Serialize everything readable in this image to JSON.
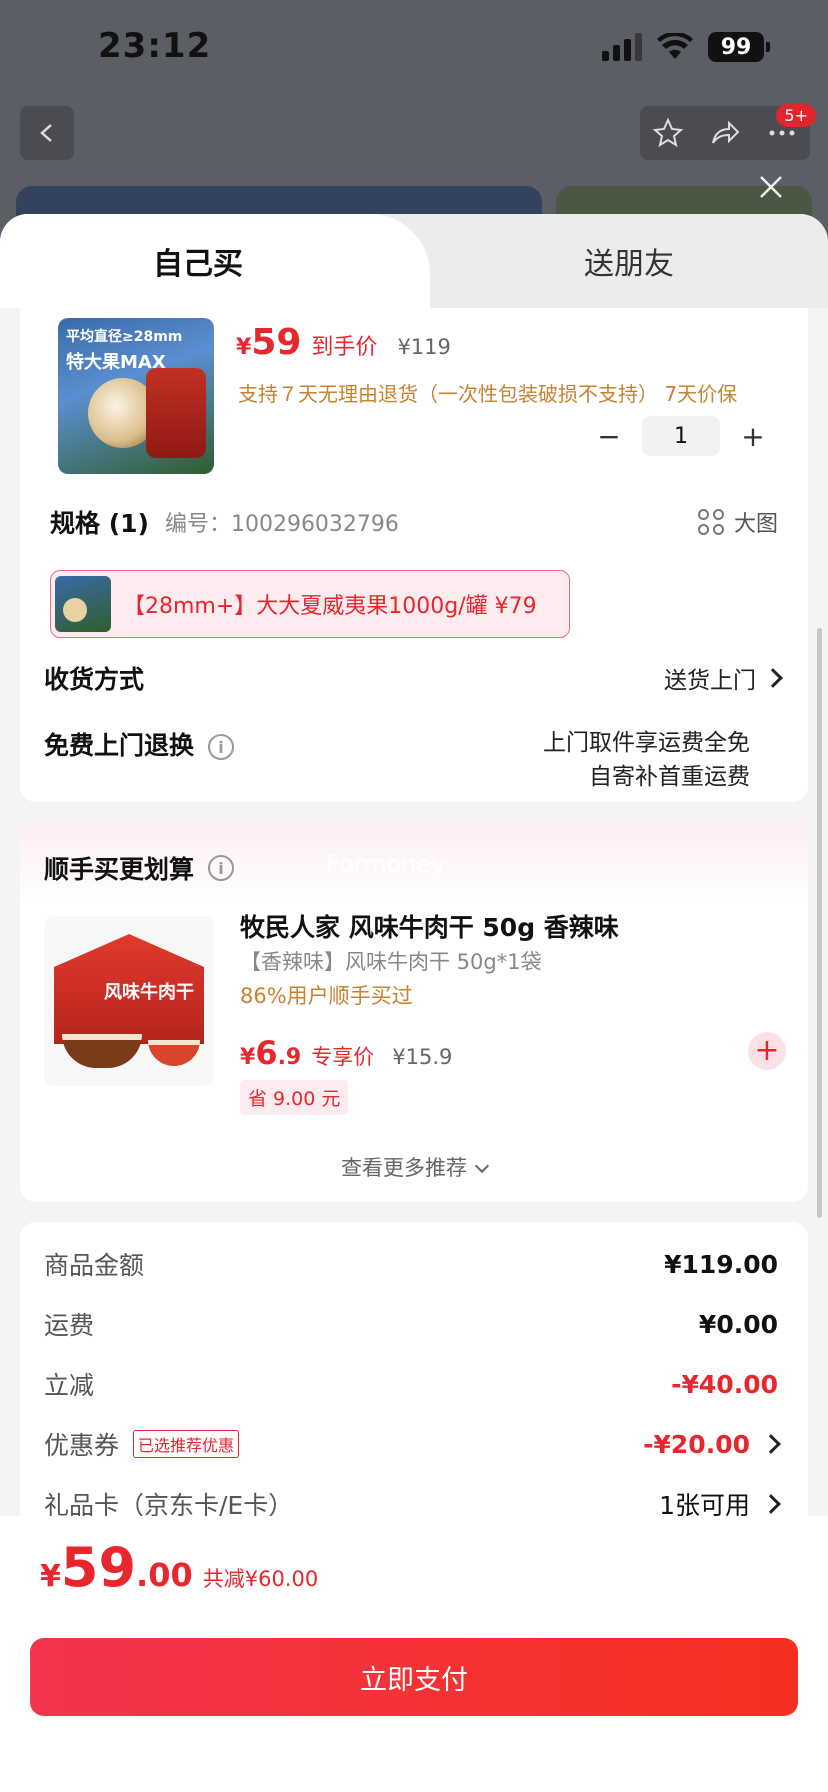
{
  "status": {
    "time": "23:12",
    "battery": "99"
  },
  "nav": {
    "badge": "5+"
  },
  "tabs": {
    "self": "自己买",
    "gift": "送朋友"
  },
  "product": {
    "image_text_1": "平均直径≥28mm",
    "image_text_2": "特大果MAX",
    "price_currency": "¥",
    "price": "59",
    "price_label": "到手价",
    "original_price": "¥119",
    "return_note": "支持７天无理由退货（一次性包装破损不支持） 7天价保",
    "quantity": "1",
    "qty_minus": "−",
    "qty_plus": "+"
  },
  "spec": {
    "title": "规格 (1)",
    "number": "编号：100296032796",
    "big_image": "大图",
    "selected_sku": "【28mm+】大大夏威夷果1000g/罐  ¥79"
  },
  "shipping": {
    "label": "收货方式",
    "value": "送货上门"
  },
  "free_return": {
    "label": "免费上门退换",
    "line1": "上门取件享运费全免",
    "line2": "自寄补首重运费"
  },
  "addon": {
    "title": "顺手买更划算",
    "watermark": "Formoney",
    "image_label": "风味牛肉干",
    "name": "牧民人家 风味牛肉干 50g 香辣味",
    "spec": "【香辣味】风味牛肉干 50g*1袋",
    "buyers": "86%用户顺手买过",
    "price_currency": "¥",
    "price_int": "6",
    "price_dec": ".9",
    "price_label": "专享价",
    "original_price": "¥15.9",
    "save": "省 9.00 元",
    "add": "+",
    "more": "查看更多推荐"
  },
  "summary": {
    "goods_label": "商品金额",
    "goods_value": "¥119.00",
    "shipping_label": "运费",
    "shipping_value": "¥0.00",
    "discount_label": "立减",
    "discount_value": "-¥40.00",
    "coupon_label": "优惠券",
    "coupon_chip": "已选推荐优惠",
    "coupon_value": "-¥20.00",
    "giftcard_label": "礼品卡（京东卡/E卡）",
    "giftcard_value": "1张可用"
  },
  "footer": {
    "currency": "¥",
    "total_int": "59",
    "total_dec": ".00",
    "total_saved": "共减¥60.00",
    "pay_button": "立即支付"
  },
  "colors": {
    "accent": "#e8262e",
    "orange_note": "#c9822f"
  }
}
